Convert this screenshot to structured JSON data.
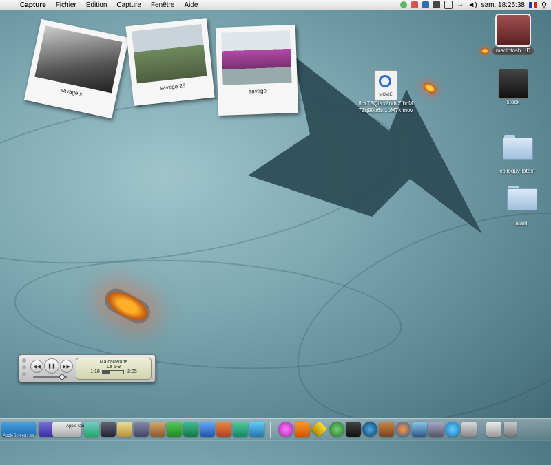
{
  "menubar": {
    "app": "Capture",
    "items": [
      "Fichier",
      "Édition",
      "Capture",
      "Fenêtre",
      "Aide"
    ],
    "clock": "sam. 18:25:38",
    "flag": "FR"
  },
  "polaroids": [
    {
      "caption": "savage x",
      "color": "#8a8a8a"
    },
    {
      "caption": "savage 25",
      "color": "#7a8a6a"
    },
    {
      "caption": "savage",
      "color": "#b24aa6"
    }
  ],
  "desktop_icons": {
    "movie_file": {
      "badge": "MOVIE",
      "name_line1": "8cxT3QtKxZndvZfbcM",
      "name_line2": "7Zq90p6s...oM7k.mov"
    },
    "hd": "macintosh HD",
    "stock": "stock",
    "colloquy": "colloquy-latest",
    "alain": "alain"
  },
  "itunes": {
    "song": "Ma caravane",
    "artist": "Le 6-9",
    "elapsed": "1:18",
    "remaining": "-2:05",
    "progress": 0.38
  },
  "dock": {
    "label_left": "AppleScreens.es",
    "label_apple": "Apple Cine"
  }
}
